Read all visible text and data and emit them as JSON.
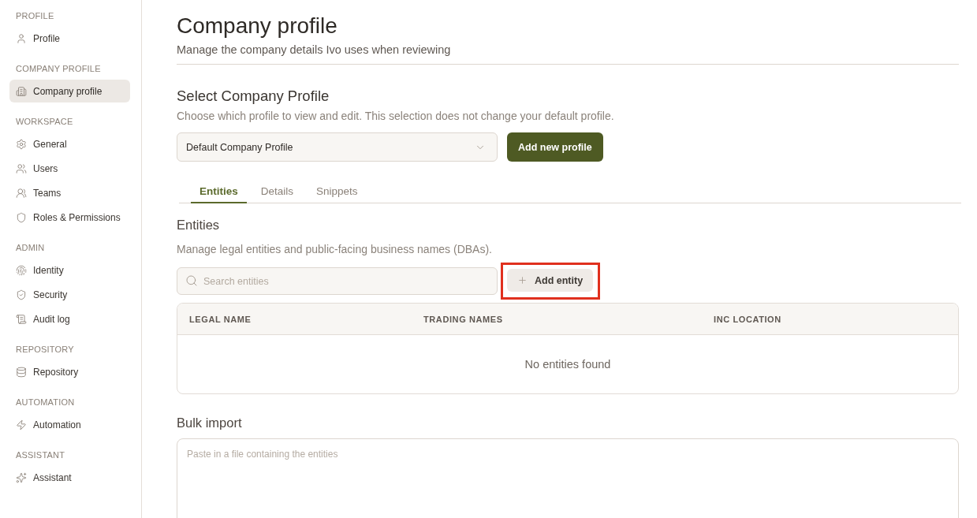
{
  "sidebar": {
    "sections": [
      {
        "heading": "PROFILE",
        "items": [
          {
            "label": "Profile",
            "selected": false
          }
        ]
      },
      {
        "heading": "COMPANY PROFILE",
        "items": [
          {
            "label": "Company profile",
            "selected": true
          }
        ]
      },
      {
        "heading": "WORKSPACE",
        "items": [
          {
            "label": "General",
            "selected": false
          },
          {
            "label": "Users",
            "selected": false
          },
          {
            "label": "Teams",
            "selected": false
          },
          {
            "label": "Roles & Permissions",
            "selected": false
          }
        ]
      },
      {
        "heading": "ADMIN",
        "items": [
          {
            "label": "Identity",
            "selected": false
          },
          {
            "label": "Security",
            "selected": false
          },
          {
            "label": "Audit log",
            "selected": false
          }
        ]
      },
      {
        "heading": "REPOSITORY",
        "items": [
          {
            "label": "Repository",
            "selected": false
          }
        ]
      },
      {
        "heading": "AUTOMATION",
        "items": [
          {
            "label": "Automation",
            "selected": false
          }
        ]
      },
      {
        "heading": "ASSISTANT",
        "items": [
          {
            "label": "Assistant",
            "selected": false
          }
        ]
      }
    ]
  },
  "header": {
    "title": "Company profile",
    "subtitle": "Manage the company details Ivo uses when reviewing"
  },
  "profile_selector": {
    "heading": "Select Company Profile",
    "description": "Choose which profile to view and edit. This selection does not change your default profile.",
    "dropdown": {
      "value": "Default Company Profile"
    },
    "add_button": {
      "label": "Add new profile"
    }
  },
  "tabs": [
    {
      "label": "Entities",
      "selected": true
    },
    {
      "label": "Details",
      "selected": false
    },
    {
      "label": "Snippets",
      "selected": false
    }
  ],
  "entities": {
    "heading": "Entities",
    "description": "Manage legal entities and public-facing business names (DBAs).",
    "search": {
      "placeholder": "Search entities"
    },
    "add_button": {
      "label": "Add entity",
      "highlighted": true
    },
    "table": {
      "columns": [
        "LEGAL NAME",
        "TRADING NAMES",
        "INC LOCATION"
      ],
      "empty_message": "No entities found"
    }
  },
  "bulk_import": {
    "heading": "Bulk import",
    "field": {
      "placeholder": "Paste in a file containing the entities"
    }
  }
}
